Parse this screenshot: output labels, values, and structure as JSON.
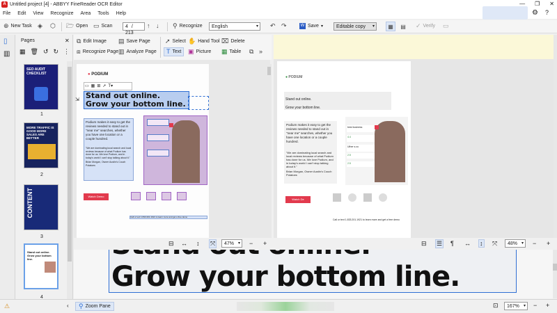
{
  "window": {
    "title": "Untitled project [4] - ABBYY FineReader OCR Editor",
    "logo": "A",
    "minimize": "—",
    "maximize": "❐",
    "close": "✕"
  },
  "menu": [
    "File",
    "Edit",
    "View",
    "Recognize",
    "Area",
    "Tools",
    "Help"
  ],
  "toolbar": {
    "new_task": "New Task",
    "open": "Open",
    "scan": "Scan",
    "page_current": "4",
    "page_total": "/ 213",
    "recognize": "Recognize",
    "language": "English",
    "save": "Save",
    "mode": "Editable copy",
    "verify": "Verify"
  },
  "pages_panel": {
    "title": "Pages",
    "thumbs": [
      {
        "num": "1",
        "text": "SEO AUDIT CHECKLIST"
      },
      {
        "num": "2",
        "text": "MORE TRAFFIC IS GOOD MORE SALES ARE BETTER"
      },
      {
        "num": "3",
        "text": "CONTENT"
      },
      {
        "num": "4",
        "text": "Stand out online. Grow your bottom line."
      }
    ]
  },
  "image_tools": {
    "edit_image": "Edit Image",
    "recognize_page": "Recognize Page",
    "save_page": "Save Page",
    "analyze_page": "Analyze Page",
    "select": "Select",
    "hand_tool": "Hand Tool",
    "delete": "Delete",
    "text": "Text",
    "picture": "Picture",
    "table": "Table"
  },
  "image_page": {
    "brand": "PODIUM",
    "headline1": "Stand out online.",
    "headline2": "Grow your bottom line.",
    "body": "Podium makes it easy to get the reviews needed to stand out in \"near me\" searches, whether you have one location or a couple hundred.",
    "quote": "\"We are dominating local search and local reviews because of what Podium has done for us. We love Podium, and in today's world I can't stop talking about it.\"",
    "attribution": "Brian Morgan, Owner Austin's Couch Potatoes",
    "cta": "Watch Demo",
    "footer": "Call or text 1.833.201.1921 to learn more and get a free demo"
  },
  "text_page": {
    "brand": "PODIUM",
    "line1": "Stand out online.",
    "line2": "Grow your bottom line.",
    "body": "Podium makes it easy to get the reviews needed to stand out in \"near me\" searches, whether you have one location or a couple hundred.",
    "quote": "\"We are dominating local search and local reviews because of what Podium has done for us. We love Podium, and in today's world I can't stop talking about it.\"",
    "attribution": "Brian Morgan, Owner Austin's Couch Potatoes",
    "cta": "Watch De",
    "footer": "Call or text 1.833.201.1921 to learn more and get a free demo",
    "best_business": "best business",
    "uther": "Uther s.cu",
    "rating1": "4.4",
    "rating2": "2.5",
    "rating3": "2.5"
  },
  "zoom": {
    "image_zoom": "47%",
    "text_zoom": "48%",
    "bottom_zoom": "167%",
    "minus": "−",
    "plus": "+"
  },
  "zoom_pane": {
    "label": "Zoom Pane",
    "line1": "Stand out online.",
    "line2": "Grow your bottom line."
  },
  "colors": {
    "accent_red": "#e23a4d",
    "select_blue": "#2f6fd4"
  }
}
